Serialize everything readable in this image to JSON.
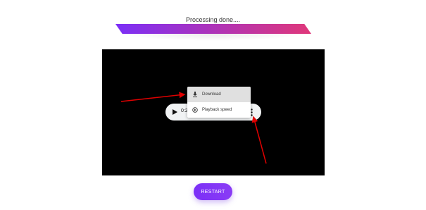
{
  "status": {
    "text": "Processing done...."
  },
  "progress": {
    "fraction": 1.0,
    "color_start": "#7b2ff7",
    "color_end": "#e0387a"
  },
  "video": {
    "background": "#000000"
  },
  "player": {
    "time": "0:25",
    "icons": {
      "play": "play-icon",
      "more": "more-vert-icon"
    }
  },
  "menu": {
    "items": [
      {
        "label": "Download",
        "icon": "download-icon",
        "highlighted": true
      },
      {
        "label": "Playback speed",
        "icon": "playback-speed-icon",
        "highlighted": false
      }
    ]
  },
  "annotations": {
    "arrow_color": "#e00000"
  },
  "restart": {
    "label": "RESTART",
    "color": "#7b2ff7"
  }
}
